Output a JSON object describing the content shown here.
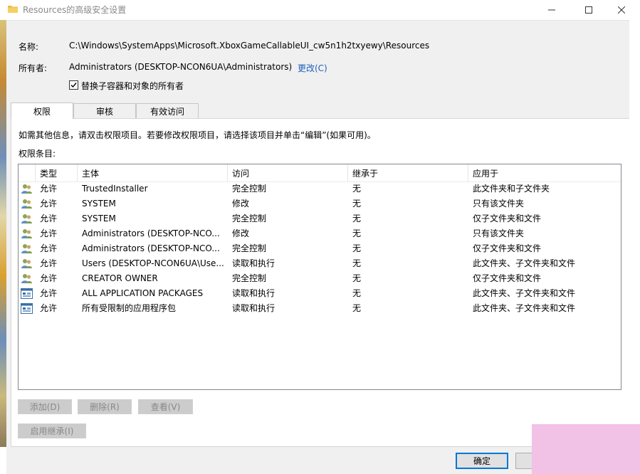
{
  "window": {
    "title": "Resources的高级安全设置"
  },
  "name_row": {
    "label": "名称:",
    "value": "C:\\Windows\\SystemApps\\Microsoft.XboxGameCallableUI_cw5n1h2txyewy\\Resources"
  },
  "owner_row": {
    "label": "所有者:",
    "value": "Administrators (DESKTOP-NCON6UA\\Administrators)",
    "change_link": "更改(C)"
  },
  "replace_owner": {
    "label": "替换子容器和对象的所有者",
    "checked": true
  },
  "tabs": [
    {
      "label": "权限"
    },
    {
      "label": "审核"
    },
    {
      "label": "有效访问"
    }
  ],
  "info_text": "如需其他信息，请双击权限项目。若要修改权限项目，请选择该项目并单击“编辑”(如果可用)。",
  "entries_label": "权限条目:",
  "columns": {
    "type": "类型",
    "principal": "主体",
    "access": "访问",
    "inherited": "继承于",
    "applies": "应用于"
  },
  "rows": [
    {
      "icon": "user-group-icon",
      "type": "允许",
      "principal": "TrustedInstaller",
      "access": "完全控制",
      "inherited": "无",
      "applies": "此文件夹和子文件夹"
    },
    {
      "icon": "user-group-icon",
      "type": "允许",
      "principal": "SYSTEM",
      "access": "修改",
      "inherited": "无",
      "applies": "只有该文件夹"
    },
    {
      "icon": "user-group-icon",
      "type": "允许",
      "principal": "SYSTEM",
      "access": "完全控制",
      "inherited": "无",
      "applies": "仅子文件夹和文件"
    },
    {
      "icon": "user-group-icon",
      "type": "允许",
      "principal": "Administrators (DESKTOP-NCO...",
      "access": "修改",
      "inherited": "无",
      "applies": "只有该文件夹"
    },
    {
      "icon": "user-group-icon",
      "type": "允许",
      "principal": "Administrators (DESKTOP-NCO...",
      "access": "完全控制",
      "inherited": "无",
      "applies": "仅子文件夹和文件"
    },
    {
      "icon": "user-group-icon",
      "type": "允许",
      "principal": "Users (DESKTOP-NCON6UA\\Use...",
      "access": "读取和执行",
      "inherited": "无",
      "applies": "此文件夹、子文件夹和文件"
    },
    {
      "icon": "user-group-icon",
      "type": "允许",
      "principal": "CREATOR OWNER",
      "access": "完全控制",
      "inherited": "无",
      "applies": "仅子文件夹和文件"
    },
    {
      "icon": "app-package-icon",
      "type": "允许",
      "principal": "ALL APPLICATION PACKAGES",
      "access": "读取和执行",
      "inherited": "无",
      "applies": "此文件夹、子文件夹和文件"
    },
    {
      "icon": "app-package-icon",
      "type": "允许",
      "principal": "所有受限制的应用程序包",
      "access": "读取和执行",
      "inherited": "无",
      "applies": "此文件夹、子文件夹和文件"
    }
  ],
  "buttons": {
    "add": "添加(D)",
    "remove": "删除(R)",
    "view": "查看(V)",
    "enable_inheritance": "启用继承(I)",
    "ok": "确定"
  }
}
